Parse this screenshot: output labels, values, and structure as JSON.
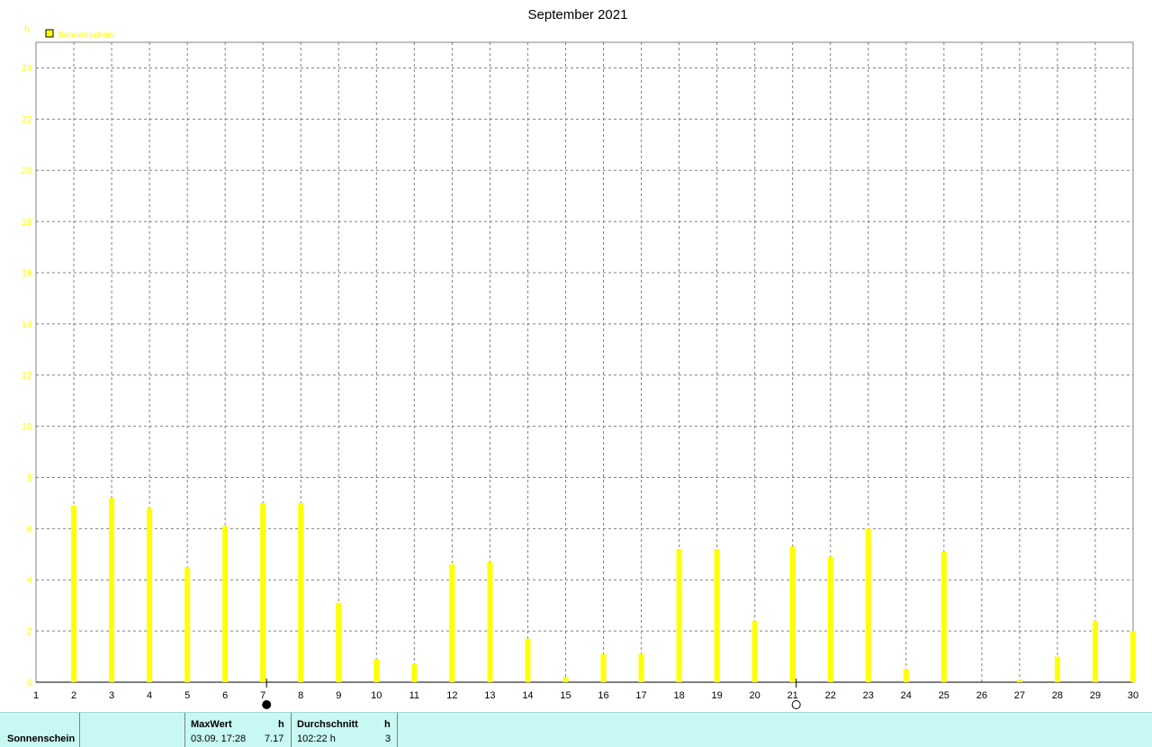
{
  "chart_data": {
    "type": "bar",
    "title": "September 2021",
    "ylabel": "h",
    "legend": "Sonnenschein",
    "series_color": "#ffff00",
    "ylim": [
      0,
      25
    ],
    "yticks": [
      0,
      2,
      4,
      6,
      8,
      10,
      12,
      14,
      16,
      18,
      20,
      22,
      24
    ],
    "categories": [
      1,
      2,
      3,
      4,
      5,
      6,
      7,
      8,
      9,
      10,
      11,
      12,
      13,
      14,
      15,
      16,
      17,
      18,
      19,
      20,
      21,
      22,
      23,
      24,
      25,
      26,
      27,
      28,
      29,
      30
    ],
    "values": [
      0,
      6.9,
      7.2,
      6.8,
      4.5,
      6.1,
      7.0,
      7.0,
      3.1,
      0.9,
      0.7,
      4.6,
      4.7,
      1.7,
      0.2,
      1.1,
      1.1,
      5.2,
      5.2,
      2.4,
      5.3,
      4.9,
      6.0,
      0.5,
      5.1,
      0,
      0.1,
      1.0,
      2.4,
      2.0
    ],
    "grid": true,
    "moon_phases": [
      {
        "day": 7,
        "phase": "new-moon"
      },
      {
        "day": 21,
        "phase": "full-moon"
      }
    ]
  },
  "footer": {
    "series_name": "Sonnenschein",
    "maxwert_label": "MaxWert",
    "maxwert_unit": "h",
    "maxwert_time": "03.09.  17:28",
    "maxwert_value": "7.17",
    "avg_label": "Durchschnitt",
    "avg_unit": "h",
    "avg_value": "102:22 h",
    "avg_extra": "3"
  }
}
